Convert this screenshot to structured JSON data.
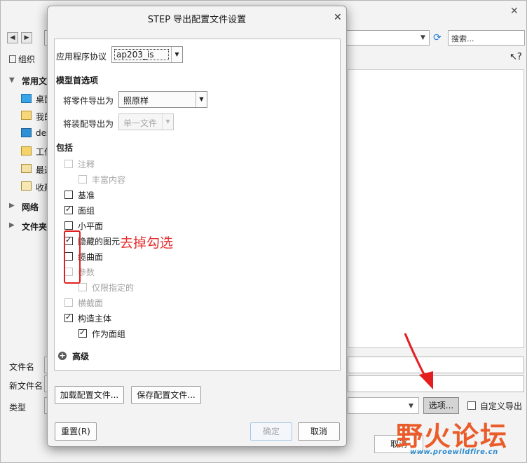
{
  "bg_dialog": {
    "search_placeholder": "搜索...",
    "organize_label": "组织",
    "help_label": "?",
    "sidebar": [
      {
        "label": "常用文",
        "kind": "section",
        "icon": "star-folder-icon"
      },
      {
        "label": "桌面",
        "kind": "item",
        "icon": "desktop-icon"
      },
      {
        "label": "我的",
        "kind": "item",
        "icon": "my-docs-icon"
      },
      {
        "label": "des",
        "kind": "item",
        "icon": "monitor-icon"
      },
      {
        "label": "工作",
        "kind": "item",
        "icon": "work-folder-icon"
      },
      {
        "label": "最近",
        "kind": "item",
        "icon": "recent-icon"
      },
      {
        "label": "收藏",
        "kind": "item",
        "icon": "favorites-icon"
      },
      {
        "label": "网络",
        "kind": "section",
        "icon": "network-icon"
      },
      {
        "label": "文件夹",
        "kind": "section",
        "icon": "folder-icon"
      }
    ],
    "filename_label": "文件名",
    "new_filename_label": "新文件名",
    "type_label": "类型",
    "options_button": "选项...",
    "custom_export_label": "自定义导出",
    "cancel_button": "取消"
  },
  "dialog": {
    "title": "STEP 导出配置文件设置",
    "protocol_label": "应用程序协议",
    "protocol_value": "ap203_is",
    "model_prefs_heading": "模型首选项",
    "part_export_label": "将零件导出为",
    "part_export_value": "照原样",
    "asm_export_label": "将装配导出为",
    "asm_export_value": "单一文件",
    "include_heading": "包括",
    "options": [
      {
        "key": "annotation",
        "label": "注释",
        "checked": false,
        "enabled": false,
        "indent": 0
      },
      {
        "key": "rich_content",
        "label": "丰富内容",
        "checked": false,
        "enabled": false,
        "indent": 1
      },
      {
        "key": "datum",
        "label": "基准",
        "checked": false,
        "enabled": true,
        "indent": 0
      },
      {
        "key": "quilts",
        "label": "面组",
        "checked": true,
        "enabled": true,
        "indent": 0
      },
      {
        "key": "facets",
        "label": "小平面",
        "checked": false,
        "enabled": true,
        "indent": 0
      },
      {
        "key": "hidden_entities",
        "label": "隐藏的图元",
        "checked": true,
        "enabled": true,
        "indent": 0
      },
      {
        "key": "cable_surfaces",
        "label": "缆曲面",
        "checked": false,
        "enabled": true,
        "indent": 0
      },
      {
        "key": "parameters",
        "label": "参数",
        "checked": false,
        "enabled": false,
        "indent": 0
      },
      {
        "key": "designated_only",
        "label": "仅限指定的",
        "checked": false,
        "enabled": false,
        "indent": 1
      },
      {
        "key": "cross_sections",
        "label": "横截面",
        "checked": false,
        "enabled": false,
        "indent": 0
      },
      {
        "key": "construction_body",
        "label": "构造主体",
        "checked": true,
        "enabled": true,
        "indent": 0
      },
      {
        "key": "as_quilt",
        "label": "作为面组",
        "checked": true,
        "enabled": true,
        "indent": 1
      }
    ],
    "advanced_label": "高级",
    "load_config_button": "加载配置文件...",
    "save_config_button": "保存配置文件...",
    "reset_button": "重置(R)",
    "ok_button": "确定",
    "cancel_button": "取消"
  },
  "annotation": {
    "text": "去掉勾选",
    "color": "#e53030"
  },
  "watermark": {
    "main": "野火论坛",
    "url": "www.proewildfire.cn"
  }
}
